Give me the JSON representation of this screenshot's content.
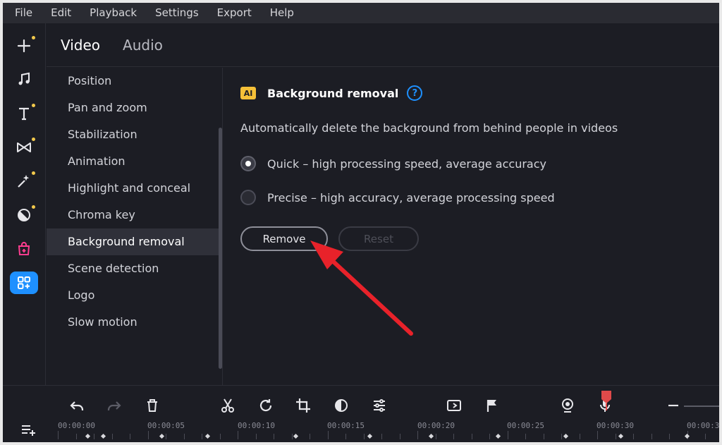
{
  "menu": [
    "File",
    "Edit",
    "Playback",
    "Settings",
    "Export",
    "Help"
  ],
  "tools": [
    {
      "icon": "add-icon",
      "dot": true
    },
    {
      "icon": "music-icon",
      "dot": false
    },
    {
      "icon": "titles-icon",
      "dot": true
    },
    {
      "icon": "transitions-icon",
      "dot": true
    },
    {
      "icon": "effects-icon",
      "dot": true
    },
    {
      "icon": "filters-icon",
      "dot": true
    },
    {
      "icon": "store-icon",
      "dot": false
    },
    {
      "icon": "more-tools-icon",
      "dot": false,
      "active": true
    }
  ],
  "tabs": {
    "video": "Video",
    "audio": "Audio"
  },
  "effects": [
    "Position",
    "Pan and zoom",
    "Stabilization",
    "Animation",
    "Highlight and conceal",
    "Chroma key",
    "Background removal",
    "Scene detection",
    "Logo",
    "Slow motion"
  ],
  "active_effect": "Background removal",
  "panel": {
    "badge": "AI",
    "title": "Background removal",
    "help": "?",
    "description": "Automatically delete the background from behind people in videos",
    "options": [
      {
        "label": "Quick – high processing speed, average accuracy",
        "checked": true
      },
      {
        "label": "Precise – high accuracy, average processing speed",
        "checked": false
      }
    ],
    "remove_label": "Remove",
    "reset_label": "Reset"
  },
  "timeline": {
    "times": [
      "00:00:00",
      "00:00:05",
      "00:00:10",
      "00:00:15",
      "00:00:20",
      "00:00:25",
      "00:00:30",
      "00:00:3"
    ],
    "toolbar_icons": [
      "undo-icon",
      "redo-icon",
      "delete-icon",
      "cut-icon",
      "rotate-icon",
      "crop-icon",
      "color-adjust-icon",
      "settings-sliders-icon",
      "transition-wizard-icon",
      "flag-icon",
      "webcam-icon",
      "microphone-icon",
      "zoom-out-icon"
    ]
  },
  "colors": {
    "accent": "#1e90ff",
    "badge": "#f5c038",
    "arrow": "#e8222a",
    "playhead": "#e04a4a"
  }
}
